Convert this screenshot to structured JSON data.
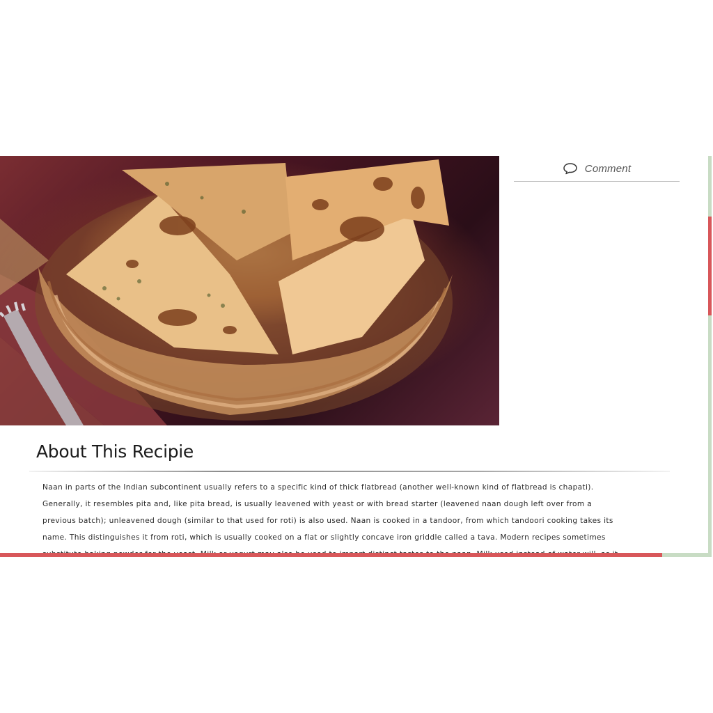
{
  "article": {
    "photo_alt": "Naan in a wicker basket",
    "section_title": "About This Recipie",
    "body": "Naan in parts of the Indian subcontinent usually refers to a specific kind of thick flatbread (another well-known kind of flatbread is chapati). Generally, it resembles pita and, like pita bread, is usually leavened with yeast or with bread starter (leavened naan dough left over from a previous batch); unleavened dough (similar to that used for roti) is also used. Naan is cooked in a tandoor, from which tandoori cooking takes its name. This distinguishes it from roti, which is usually cooked on a flat or slightly concave iron griddle called a tava. Modern recipes sometimes substitute baking powder for the yeast. Milk or yogurt may also be used to impart distinct tastes to the naan. Milk used instead of water will, as it does for ordinary bread, yield a softer"
  },
  "sidebar": {
    "comment_label": "Comment",
    "comment_icon": "speech-bubble-icon"
  },
  "scroll": {
    "vertical_position": 0.2,
    "reading_progress": 0.935
  },
  "colors": {
    "accent": "#d8575a",
    "track": "#c8dcc4"
  }
}
